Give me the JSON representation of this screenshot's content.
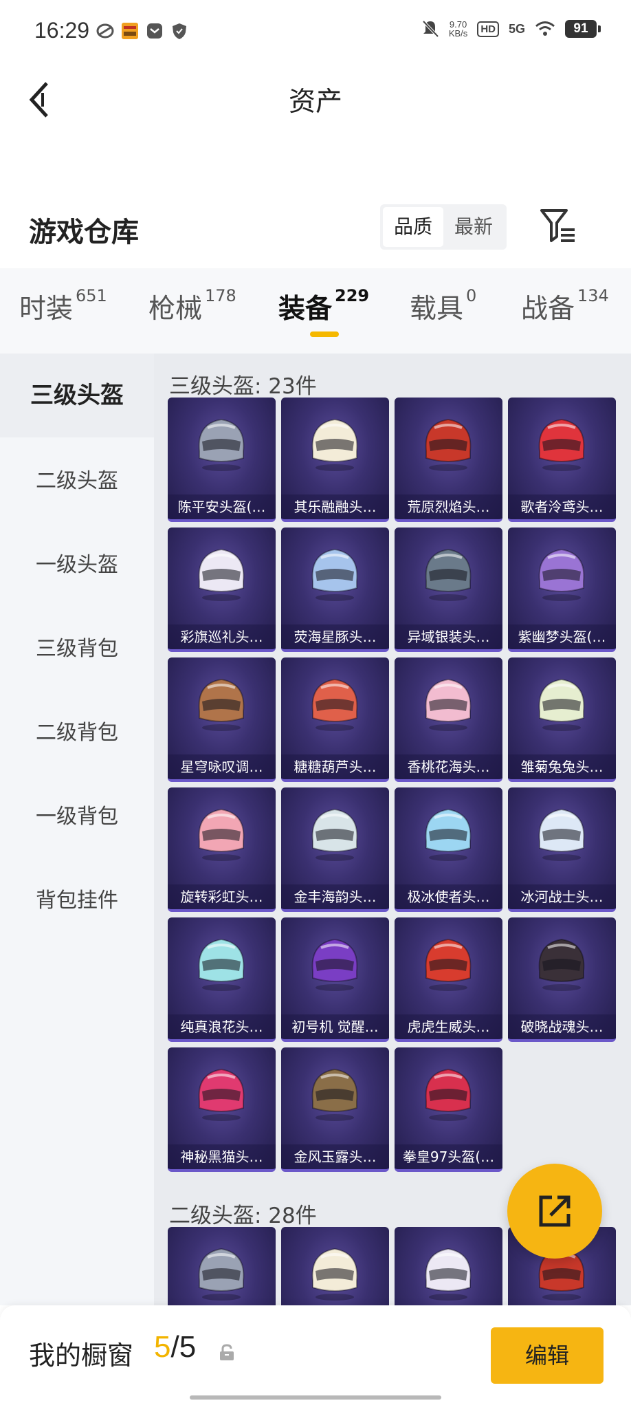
{
  "status_bar": {
    "time": "16:29",
    "net_speed": "9.70",
    "net_unit": "KB/s",
    "hd": "HD",
    "network": "5G",
    "battery": "91"
  },
  "header": {
    "title": "资产"
  },
  "warehouse": {
    "title": "游戏仓库",
    "sort_options": [
      {
        "label": "品质",
        "active": true
      },
      {
        "label": "最新",
        "active": false
      }
    ]
  },
  "tabs": [
    {
      "label": "时装",
      "count": "651"
    },
    {
      "label": "枪械",
      "count": "178"
    },
    {
      "label": "装备",
      "count": "229",
      "active": true
    },
    {
      "label": "载具",
      "count": "0"
    },
    {
      "label": "战备",
      "count": "134"
    }
  ],
  "sidebar": [
    {
      "label": "三级头盔",
      "active": true
    },
    {
      "label": "二级头盔"
    },
    {
      "label": "一级头盔"
    },
    {
      "label": "三级背包"
    },
    {
      "label": "二级背包"
    },
    {
      "label": "一级背包"
    },
    {
      "label": "背包挂件"
    }
  ],
  "groups": [
    {
      "title": "三级头盔: 23件",
      "items": [
        {
          "name": "陈平安头盔(…",
          "color": "#9aa2b4"
        },
        {
          "name": "其乐融融头…",
          "color": "#f3ecd8"
        },
        {
          "name": "荒原烈焰头…",
          "color": "#c8382a"
        },
        {
          "name": "歌者泠鸢头…",
          "color": "#e0343c"
        },
        {
          "name": "彩旗巡礼头…",
          "color": "#ece8f4"
        },
        {
          "name": "荧海星豚头…",
          "color": "#a6c4ec"
        },
        {
          "name": "异域银装头…",
          "color": "#6a7a8a"
        },
        {
          "name": "紫幽梦头盔(…",
          "color": "#9a74d4"
        },
        {
          "name": "星穹咏叹调…",
          "color": "#b0744a"
        },
        {
          "name": "糖糖葫芦头…",
          "color": "#e0604a"
        },
        {
          "name": "香桃花海头…",
          "color": "#f2bcd0"
        },
        {
          "name": "雏菊兔兔头…",
          "color": "#e6eed0"
        },
        {
          "name": "旋转彩虹头…",
          "color": "#f2a6b4"
        },
        {
          "name": "金丰海韵头…",
          "color": "#d8e4e8"
        },
        {
          "name": "极冰使者头…",
          "color": "#9cd6f2"
        },
        {
          "name": "冰河战士头…",
          "color": "#dde8f6"
        },
        {
          "name": "纯真浪花头…",
          "color": "#9ee2e6"
        },
        {
          "name": "初号机 觉醒…",
          "color": "#7a3ec4"
        },
        {
          "name": "虎虎生威头…",
          "color": "#d83c2e"
        },
        {
          "name": "破晓战魂头…",
          "color": "#3a3038"
        },
        {
          "name": "神秘黑猫头…",
          "color": "#e03a70"
        },
        {
          "name": "金风玉露头…",
          "color": "#8a6e48"
        },
        {
          "name": "拳皇97头盔(…",
          "color": "#d8304e"
        }
      ]
    },
    {
      "title": "二级头盔: 28件",
      "items": [
        {
          "name": "",
          "color": "#9aa2b4"
        },
        {
          "name": "",
          "color": "#f3ecd8"
        },
        {
          "name": "",
          "color": "#ece8f4"
        },
        {
          "name": "",
          "color": "#c8382a"
        }
      ]
    }
  ],
  "bottom": {
    "label": "我的橱窗",
    "current": "5",
    "separator": "/",
    "total": "5",
    "edit_label": "编辑"
  }
}
